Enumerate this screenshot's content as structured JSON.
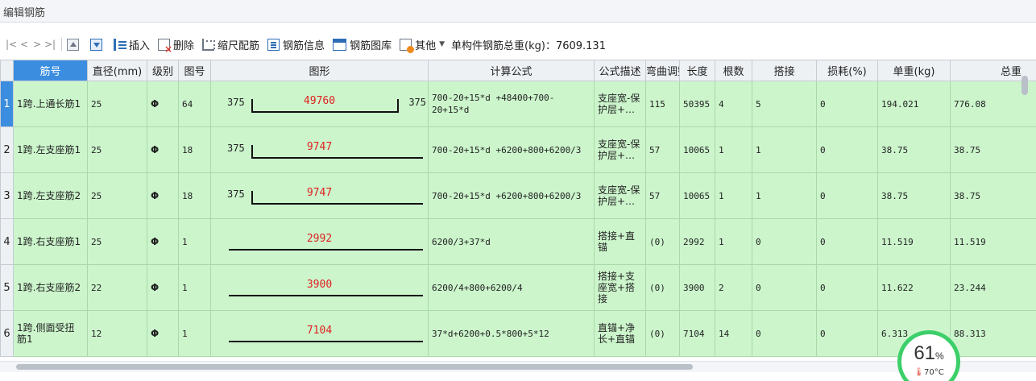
{
  "window": {
    "title": "编辑钢筋"
  },
  "toolbar": {
    "nav_first": "|<",
    "nav_prev": "<",
    "nav_next": ">",
    "nav_last": ">|",
    "insert": "插入",
    "delete": "删除",
    "scale": "缩尺配筋",
    "info": "钢筋信息",
    "library": "钢筋图库",
    "other": "其他",
    "total": "单构件钢筋总重(kg)：7609.131"
  },
  "columns": [
    "筋号",
    "直径(mm)",
    "级别",
    "图号",
    "图形",
    "计算公式",
    "公式描述",
    "弯曲调整",
    "长度",
    "根数",
    "搭接",
    "损耗(%)",
    "单重(kg)",
    "总重"
  ],
  "rows": [
    {
      "index": "1",
      "name": "1跨.上通长筋1",
      "diameter": "25",
      "grade": "Φ",
      "shape_no": "64",
      "shape": {
        "left": "375",
        "length": "49760",
        "right": "375",
        "hooks": "both"
      },
      "formula": "700-20+15*d +48400+700-20+15*d",
      "desc": "支座宽-保护层+…",
      "bend": "115",
      "length": "50395",
      "count": "4",
      "lap": "5",
      "loss": "0",
      "unit_weight": "194.021",
      "total_weight": "776.08"
    },
    {
      "index": "2",
      "name": "1跨.左支座筋1",
      "diameter": "25",
      "grade": "Φ",
      "shape_no": "18",
      "shape": {
        "left": "375",
        "length": "9747",
        "right": "",
        "hooks": "left"
      },
      "formula": "700-20+15*d +6200+800+6200/3",
      "desc": "支座宽-保护层+…",
      "bend": "57",
      "length": "10065",
      "count": "1",
      "lap": "1",
      "loss": "0",
      "unit_weight": "38.75",
      "total_weight": "38.75"
    },
    {
      "index": "3",
      "name": "1跨.左支座筋2",
      "diameter": "25",
      "grade": "Φ",
      "shape_no": "18",
      "shape": {
        "left": "375",
        "length": "9747",
        "right": "",
        "hooks": "left"
      },
      "formula": "700-20+15*d +6200+800+6200/3",
      "desc": "支座宽-保护层+…",
      "bend": "57",
      "length": "10065",
      "count": "1",
      "lap": "1",
      "loss": "0",
      "unit_weight": "38.75",
      "total_weight": "38.75"
    },
    {
      "index": "4",
      "name": "1跨.右支座筋1",
      "diameter": "25",
      "grade": "Φ",
      "shape_no": "1",
      "shape": {
        "left": "",
        "length": "2992",
        "right": "",
        "hooks": "none"
      },
      "formula": "6200/3+37*d",
      "desc": "搭接+直锚",
      "bend": "(0)",
      "length": "2992",
      "count": "1",
      "lap": "0",
      "loss": "0",
      "unit_weight": "11.519",
      "total_weight": "11.519"
    },
    {
      "index": "5",
      "name": "1跨.右支座筋2",
      "diameter": "22",
      "grade": "Φ",
      "shape_no": "1",
      "shape": {
        "left": "",
        "length": "3900",
        "right": "",
        "hooks": "none"
      },
      "formula": "6200/4+800+6200/4",
      "desc": "搭接+支座宽+搭接",
      "bend": "(0)",
      "length": "3900",
      "count": "2",
      "lap": "0",
      "loss": "0",
      "unit_weight": "11.622",
      "total_weight": "23.244"
    },
    {
      "index": "6",
      "name": "1跨.侧面受扭筋1",
      "diameter": "12",
      "grade": "Φ",
      "shape_no": "1",
      "shape": {
        "left": "",
        "length": "7104",
        "right": "",
        "hooks": "none"
      },
      "formula": "37*d+6200+0.5*800+5*12",
      "desc": "直锚+净长+直锚",
      "bend": "(0)",
      "length": "7104",
      "count": "14",
      "lap": "0",
      "loss": "0",
      "unit_weight": "6.313",
      "total_weight": "88.313"
    }
  ],
  "overlay": {
    "cpu_value": "61",
    "cpu_unit": "%",
    "temperature": "70°C",
    "accent": "#3ccf6a"
  }
}
